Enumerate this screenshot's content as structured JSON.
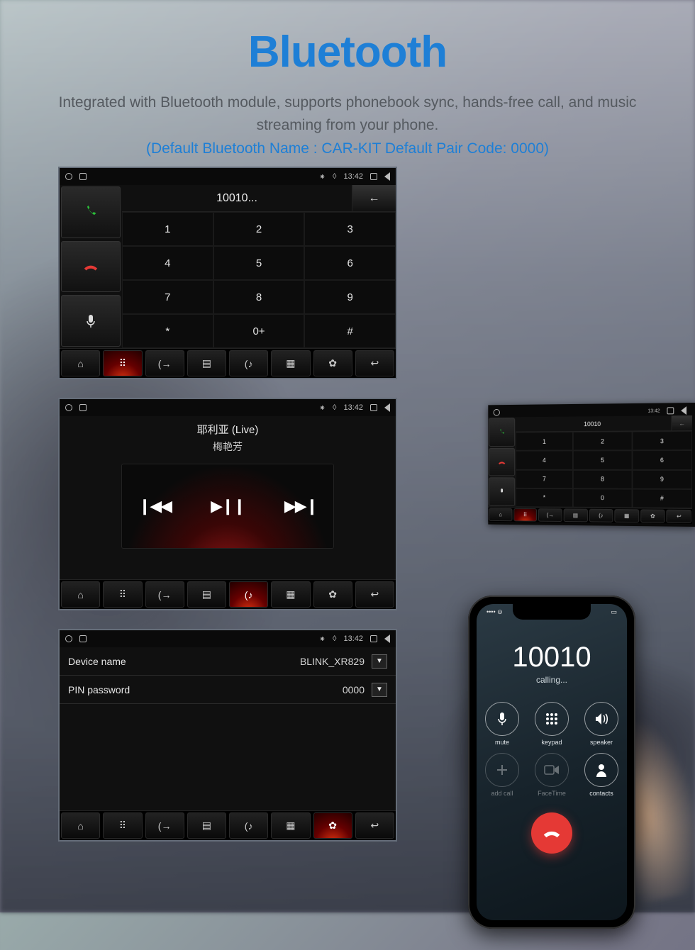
{
  "header": {
    "title": "Bluetooth",
    "line1": "Integrated with Bluetooth module, supports phonebook sync, hands-free call, and music streaming from your phone.",
    "line2": "(Default Bluetooth Name : CAR-KIT   Default Pair Code: 0000)"
  },
  "status": {
    "time": "13:42"
  },
  "dialer": {
    "display": "10010...",
    "backspace": "←",
    "keys": [
      "1",
      "2",
      "3",
      "4",
      "5",
      "6",
      "7",
      "8",
      "9",
      "*",
      "0+",
      "#"
    ]
  },
  "nav": {
    "icons": [
      "⌂",
      "⠿",
      "(→",
      "▤",
      "(♪",
      "▦",
      "✿",
      "↩"
    ],
    "active_dialer": 1,
    "active_music": 4,
    "active_settings": 6
  },
  "music": {
    "title": "耶利亚 (Live)",
    "artist": "梅艳芳",
    "prev": "❙◀◀",
    "play": "▶❙❙",
    "next": "▶▶❙"
  },
  "settings": {
    "row1_label": "Device name",
    "row1_value": "BLINK_XR829",
    "row2_label": "PIN password",
    "row2_value": "0000",
    "dd": "▼"
  },
  "dash": {
    "display": "10010",
    "time": "13:42",
    "keys": [
      "1",
      "2",
      "3",
      "4",
      "5",
      "6",
      "7",
      "8",
      "9",
      "*",
      "0",
      "#"
    ]
  },
  "phone": {
    "signal": "•••• ⊝",
    "number": "10010",
    "status": "calling...",
    "btns": [
      {
        "icon": "mic",
        "label": "mute",
        "dim": false
      },
      {
        "icon": "keypad",
        "label": "keypad",
        "dim": false
      },
      {
        "icon": "speaker",
        "label": "speaker",
        "dim": false
      },
      {
        "icon": "plus",
        "label": "add call",
        "dim": true
      },
      {
        "icon": "facetime",
        "label": "FaceTime",
        "dim": true
      },
      {
        "icon": "contacts",
        "label": "contacts",
        "dim": false
      }
    ]
  }
}
